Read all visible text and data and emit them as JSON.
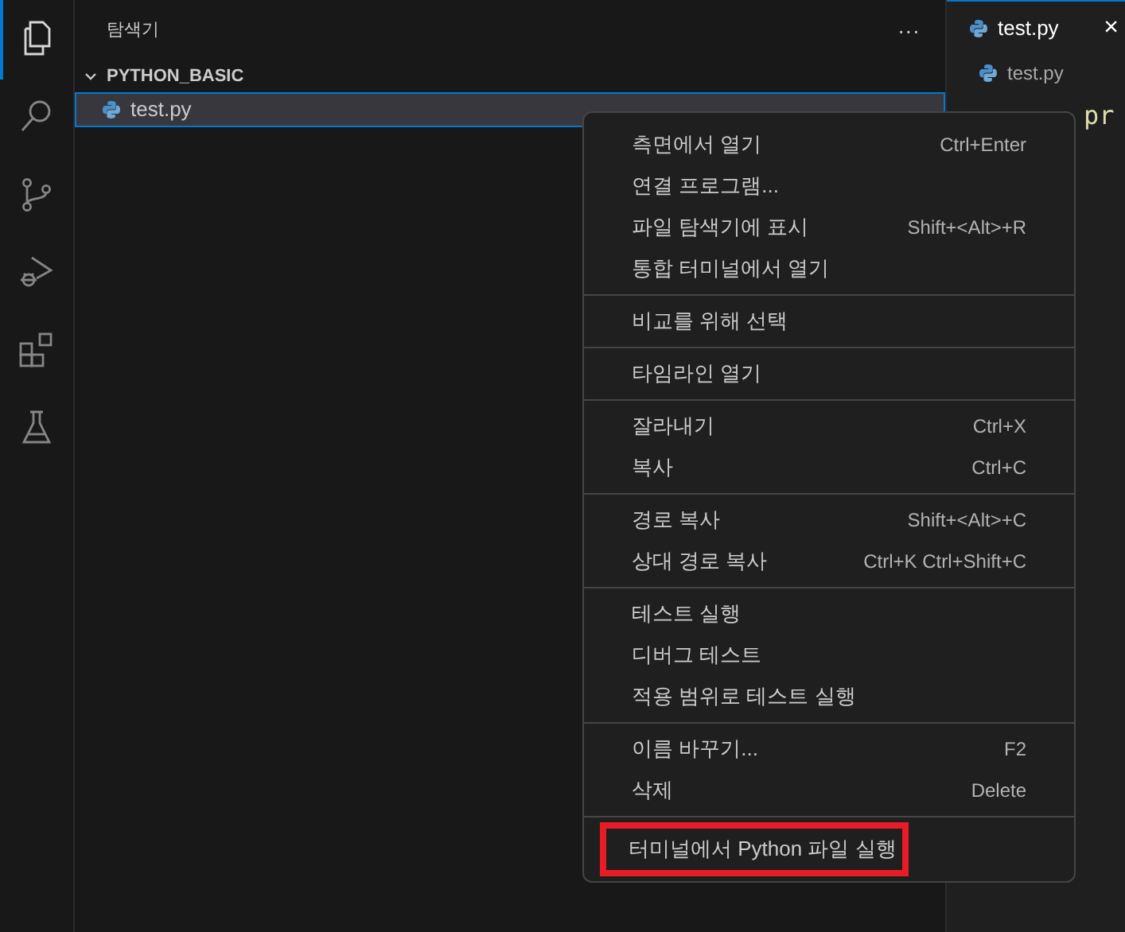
{
  "explorer": {
    "title": "탐색기",
    "more": "···",
    "folder": {
      "name": "PYTHON_BASIC",
      "expanded": true
    },
    "files": [
      {
        "name": "test.py",
        "selected": true
      }
    ]
  },
  "editor": {
    "tab": {
      "label": "test.py",
      "close": "×"
    },
    "breadcrumb": "test.py",
    "code": "pr"
  },
  "context_menu": {
    "groups": [
      [
        {
          "label": "측면에서 열기",
          "shortcut": "Ctrl+Enter",
          "highlighted": false
        },
        {
          "label": "연결 프로그램...",
          "highlighted": false
        },
        {
          "label": "파일 탐색기에 표시",
          "shortcut": "Shift+<Alt>+R",
          "highlighted": false
        },
        {
          "label": "통합 터미널에서 열기",
          "highlighted": false
        }
      ],
      [
        {
          "label": "비교를 위해 선택",
          "highlighted": false
        }
      ],
      [
        {
          "label": "타임라인 열기",
          "highlighted": false
        }
      ],
      [
        {
          "label": "잘라내기",
          "shortcut": "Ctrl+X",
          "highlighted": false
        },
        {
          "label": "복사",
          "shortcut": "Ctrl+C",
          "highlighted": false
        }
      ],
      [
        {
          "label": "경로 복사",
          "shortcut": "Shift+<Alt>+C",
          "highlighted": false
        },
        {
          "label": "상대 경로 복사",
          "shortcut": "Ctrl+K Ctrl+Shift+C",
          "highlighted": false
        }
      ],
      [
        {
          "label": "테스트 실행",
          "highlighted": false
        },
        {
          "label": "디버그 테스트",
          "highlighted": false
        },
        {
          "label": "적용 범위로 테스트 실행",
          "highlighted": false
        }
      ],
      [
        {
          "label": "이름 바꾸기...",
          "shortcut": "F2",
          "highlighted": false
        },
        {
          "label": "삭제",
          "shortcut": "Delete",
          "highlighted": false
        }
      ],
      [
        {
          "label": "터미널에서 Python 파일 실행",
          "highlighted": true
        }
      ]
    ]
  }
}
